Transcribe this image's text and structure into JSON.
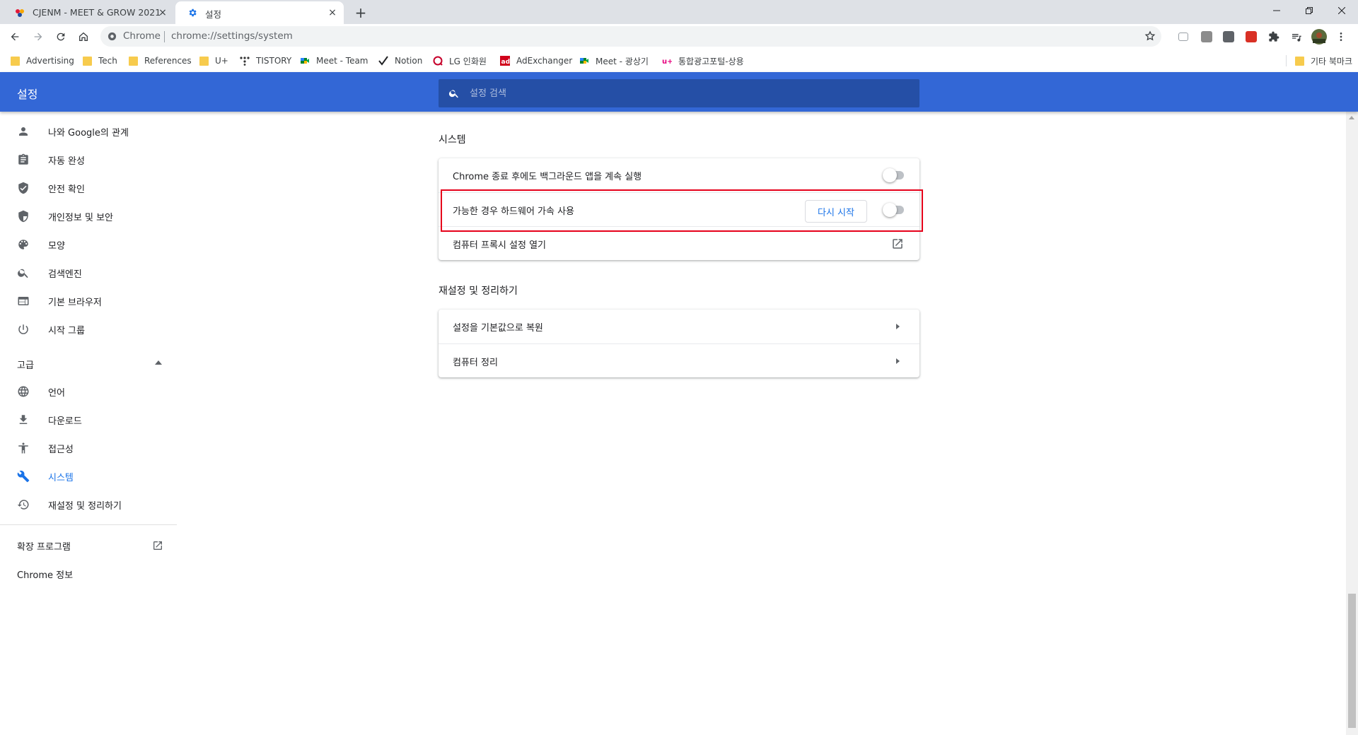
{
  "tabs": [
    {
      "title": "CJENM - MEET & GROW 2021",
      "close": "×"
    },
    {
      "title": "설정",
      "close": "×"
    }
  ],
  "new_tab": "+",
  "omnibox": {
    "scheme_label": "Chrome",
    "url": "chrome://settings/system"
  },
  "bookmarks": [
    {
      "label": "Advertising",
      "icon": "folder"
    },
    {
      "label": "Tech",
      "icon": "folder"
    },
    {
      "label": "References",
      "icon": "folder"
    },
    {
      "label": "U+",
      "icon": "folder"
    },
    {
      "label": "TISTORY",
      "icon": "tistory-icon"
    },
    {
      "label": "Meet - Team",
      "icon": "meet-icon"
    },
    {
      "label": "Notion",
      "icon": "notion-check-icon"
    },
    {
      "label": "LG 인화원",
      "icon": "lg-icon"
    },
    {
      "label": "AdExchanger",
      "icon": "ad-icon"
    },
    {
      "label": "Meet - 광상기",
      "icon": "meet-icon"
    },
    {
      "label": "통합광고포털-상용",
      "icon": "uplus-icon"
    }
  ],
  "other_bookmarks": "기타 북마크",
  "header": {
    "title": "설정",
    "search_placeholder": "설정 검색"
  },
  "sidebar": {
    "items": [
      {
        "label": "나와 Google의 관계",
        "icon": "person-icon"
      },
      {
        "label": "자동 완성",
        "icon": "clipboard-icon"
      },
      {
        "label": "안전 확인",
        "icon": "shield-check-icon"
      },
      {
        "label": "개인정보 및 보안",
        "icon": "shield-icon"
      },
      {
        "label": "모양",
        "icon": "palette-icon"
      },
      {
        "label": "검색엔진",
        "icon": "search-icon"
      },
      {
        "label": "기본 브라우저",
        "icon": "browser-icon"
      },
      {
        "label": "시작 그룹",
        "icon": "power-icon"
      }
    ],
    "advanced_label": "고급",
    "advanced_items": [
      {
        "label": "언어",
        "icon": "globe-icon"
      },
      {
        "label": "다운로드",
        "icon": "download-icon"
      },
      {
        "label": "접근성",
        "icon": "accessibility-icon"
      },
      {
        "label": "시스템",
        "icon": "wrench-icon",
        "active": true
      },
      {
        "label": "재설정 및 정리하기",
        "icon": "history-icon"
      }
    ],
    "extensions_label": "확장 프로그램",
    "about_label": "Chrome 정보"
  },
  "system": {
    "title": "시스템",
    "background_apps": {
      "label": "Chrome 종료 후에도 백그라운드 앱을 계속 실행",
      "enabled": false
    },
    "hardware_accel": {
      "label": "가능한 경우 하드웨어 가속 사용",
      "restart_label": "다시 시작",
      "enabled": false
    },
    "proxy": {
      "label": "컴퓨터 프록시 설정 열기"
    }
  },
  "reset": {
    "title": "재설정 및 정리하기",
    "items": [
      {
        "label": "설정을 기본값으로 복원"
      },
      {
        "label": "컴퓨터 정리"
      }
    ]
  },
  "colors": {
    "header": "#3367d6",
    "search_box": "#254fa6",
    "accent": "#1a73e8",
    "highlight_box": "#e6001a"
  }
}
